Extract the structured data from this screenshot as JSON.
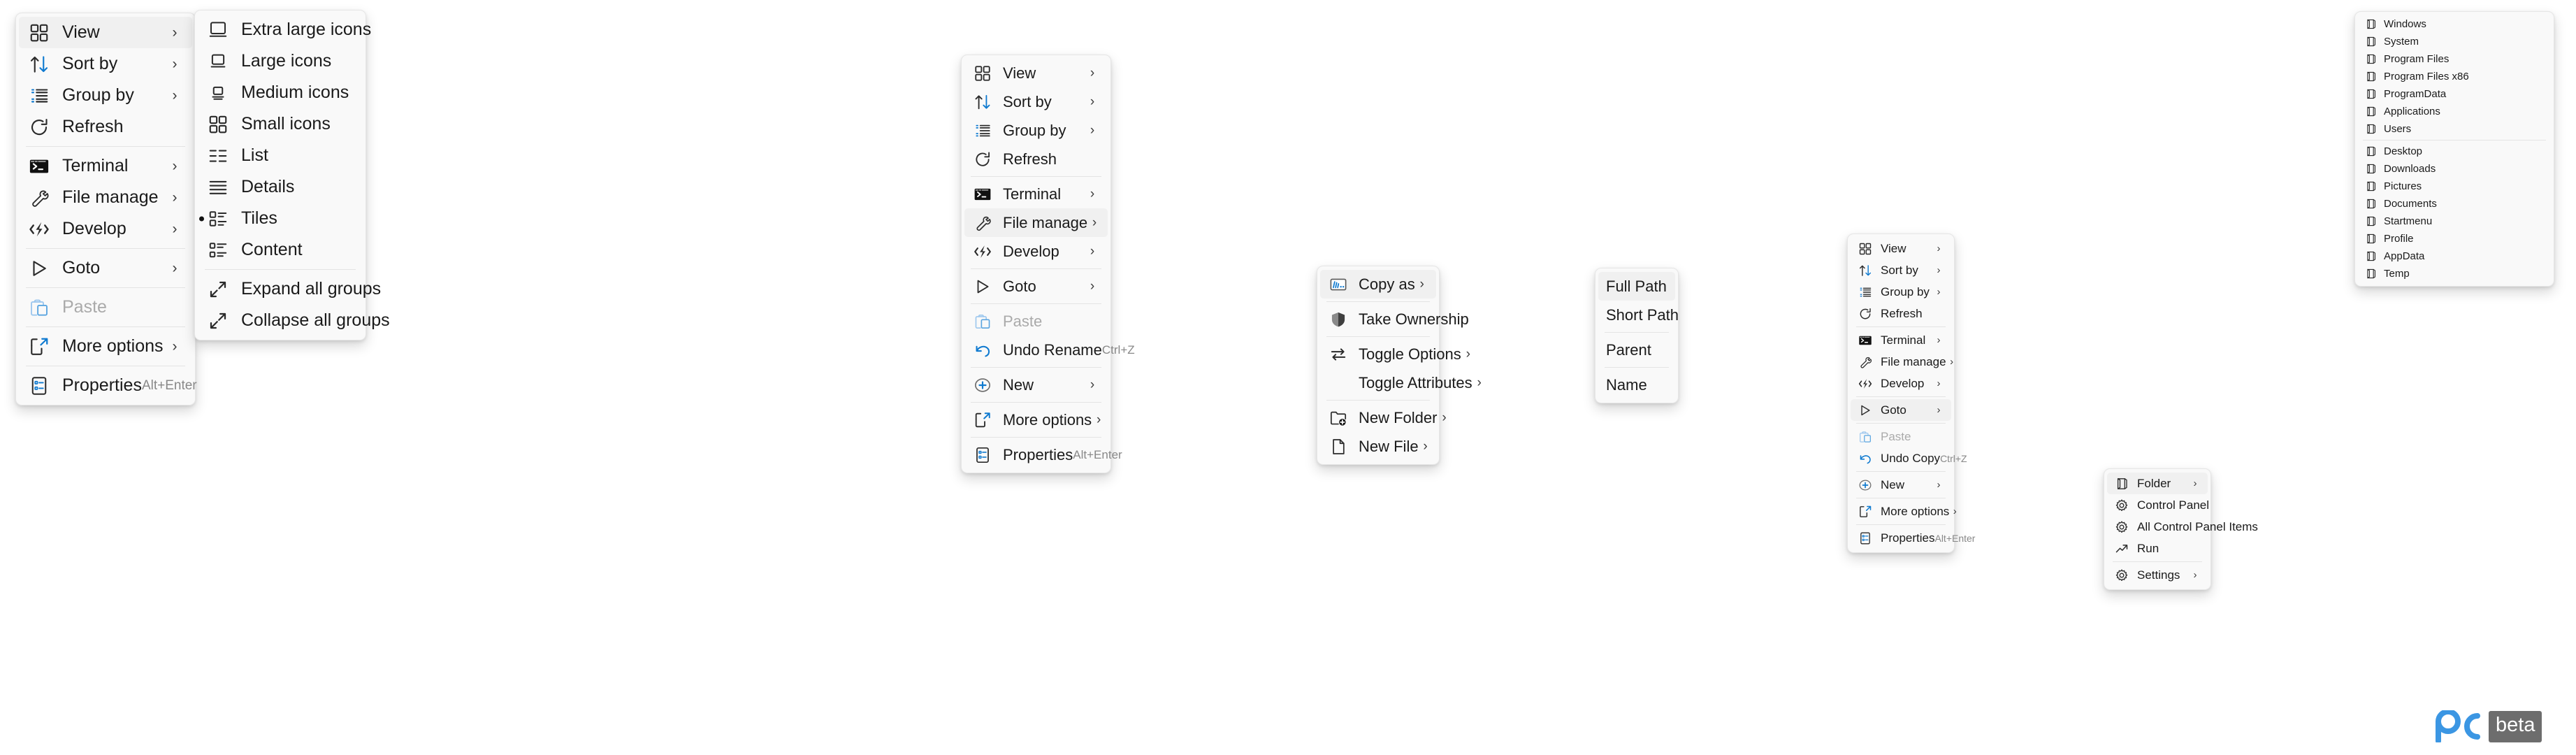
{
  "panels": {
    "root_context_menu": {
      "name": "Windows 11 desktop context menu",
      "items": [
        {
          "label": "View",
          "icon": "grid-icon",
          "submenu": true,
          "selected": true
        },
        {
          "label": "Sort by",
          "icon": "sort-icon",
          "submenu": true
        },
        {
          "label": "Group by",
          "icon": "group-icon",
          "submenu": true
        },
        {
          "label": "Refresh",
          "icon": "refresh-icon",
          "submenu": false
        },
        {
          "separator": true
        },
        {
          "label": "Terminal",
          "icon": "terminal-icon",
          "submenu": true
        },
        {
          "label": "File manage",
          "icon": "wrench-icon",
          "submenu": true
        },
        {
          "label": "Develop",
          "icon": "code-lightning-icon",
          "submenu": true
        },
        {
          "separator": true
        },
        {
          "label": "Goto",
          "icon": "play-arrow-icon",
          "submenu": true
        },
        {
          "separator": true
        },
        {
          "label": "Paste",
          "icon": "paste-icon",
          "submenu": false,
          "disabled": true
        },
        {
          "separator": true
        },
        {
          "label": "More options",
          "icon": "more-options-icon",
          "submenu": true
        },
        {
          "separator": true
        },
        {
          "label": "Properties",
          "icon": "properties-icon",
          "submenu": false,
          "accel": "Alt+Enter"
        }
      ]
    },
    "view_submenu": {
      "name": "View submenu",
      "items": [
        {
          "label": "Extra large icons",
          "icon": "monitor-xl-icon"
        },
        {
          "label": "Large icons",
          "icon": "monitor-l-icon"
        },
        {
          "label": "Medium icons",
          "icon": "monitor-m-icon"
        },
        {
          "label": "Small icons",
          "icon": "grid-icon"
        },
        {
          "label": "List",
          "icon": "list-icon"
        },
        {
          "label": "Details",
          "icon": "details-icon"
        },
        {
          "label": "Tiles",
          "icon": "tiles-icon",
          "bullet": true
        },
        {
          "label": "Content",
          "icon": "content-icon"
        },
        {
          "separator": true
        },
        {
          "label": "Expand all groups",
          "icon": "expand-icon"
        },
        {
          "label": "Collapse all groups",
          "icon": "collapse-icon"
        }
      ]
    },
    "second_context_menu": {
      "name": "Context menu with File manage highlighted",
      "items": [
        {
          "label": "View",
          "icon": "grid-icon",
          "submenu": true
        },
        {
          "label": "Sort by",
          "icon": "sort-icon",
          "submenu": true
        },
        {
          "label": "Group by",
          "icon": "group-icon",
          "submenu": true
        },
        {
          "label": "Refresh",
          "icon": "refresh-icon"
        },
        {
          "separator": true
        },
        {
          "label": "Terminal",
          "icon": "terminal-icon",
          "submenu": true
        },
        {
          "label": "File manage",
          "icon": "wrench-icon",
          "submenu": true,
          "selected": true
        },
        {
          "label": "Develop",
          "icon": "code-lightning-icon",
          "submenu": true
        },
        {
          "separator": true
        },
        {
          "label": "Goto",
          "icon": "play-arrow-icon",
          "submenu": true
        },
        {
          "separator": true
        },
        {
          "label": "Paste",
          "icon": "paste-icon",
          "disabled": true
        },
        {
          "label": "Undo Rename",
          "icon": "undo-icon",
          "accel": "Ctrl+Z"
        },
        {
          "separator": true
        },
        {
          "label": "New",
          "icon": "plus-circle-icon",
          "submenu": true
        },
        {
          "separator": true
        },
        {
          "label": "More options",
          "icon": "more-options-icon",
          "submenu": true
        },
        {
          "separator": true
        },
        {
          "label": "Properties",
          "icon": "properties-icon",
          "accel": "Alt+Enter"
        }
      ]
    },
    "file_manage_submenu": {
      "name": "File manage submenu",
      "items": [
        {
          "label": "Copy as",
          "icon": "copy-as-icon",
          "submenu": true,
          "selected": true
        },
        {
          "separator": true
        },
        {
          "label": "Take Ownership",
          "icon": "shield-icon"
        },
        {
          "separator": true
        },
        {
          "label": "Toggle Options",
          "icon": "toggle-swap-icon",
          "submenu": true
        },
        {
          "label": "Toggle Attributes",
          "icon": "none",
          "submenu": true
        },
        {
          "separator": true
        },
        {
          "label": "New Folder",
          "icon": "new-folder-icon",
          "submenu": true
        },
        {
          "label": "New File",
          "icon": "new-file-icon",
          "submenu": true
        }
      ]
    },
    "copy_as_submenu": {
      "name": "Copy as submenu",
      "items": [
        {
          "label": "Full Path",
          "selected": true
        },
        {
          "label": "Short Path"
        },
        {
          "separator": true
        },
        {
          "label": "Parent"
        },
        {
          "separator": true
        },
        {
          "label": "Name"
        }
      ]
    },
    "third_context_menu": {
      "name": "Context menu with Goto highlighted",
      "items": [
        {
          "label": "View",
          "icon": "grid-icon",
          "submenu": true
        },
        {
          "label": "Sort by",
          "icon": "sort-icon",
          "submenu": true
        },
        {
          "label": "Group by",
          "icon": "group-icon",
          "submenu": true
        },
        {
          "label": "Refresh",
          "icon": "refresh-icon"
        },
        {
          "separator": true
        },
        {
          "label": "Terminal",
          "icon": "terminal-icon",
          "submenu": true
        },
        {
          "label": "File manage",
          "icon": "wrench-icon",
          "submenu": true
        },
        {
          "label": "Develop",
          "icon": "code-lightning-icon",
          "submenu": true
        },
        {
          "separator": true
        },
        {
          "label": "Goto",
          "icon": "play-arrow-icon",
          "submenu": true,
          "selected": true
        },
        {
          "separator": true
        },
        {
          "label": "Paste",
          "icon": "paste-icon",
          "disabled": true
        },
        {
          "label": "Undo Copy",
          "icon": "undo-icon",
          "accel": "Ctrl+Z"
        },
        {
          "separator": true
        },
        {
          "label": "New",
          "icon": "plus-circle-icon",
          "submenu": true
        },
        {
          "separator": true
        },
        {
          "label": "More options",
          "icon": "more-options-icon",
          "submenu": true
        },
        {
          "separator": true
        },
        {
          "label": "Properties",
          "icon": "properties-icon",
          "accel": "Alt+Enter"
        }
      ]
    },
    "goto_submenu": {
      "name": "Goto submenu",
      "items": [
        {
          "label": "Folder",
          "icon": "folder-open-icon",
          "submenu": true,
          "selected": true
        },
        {
          "label": "Control Panel",
          "icon": "gear-icon"
        },
        {
          "label": "All Control Panel Items",
          "icon": "gear-icon"
        },
        {
          "label": "Run",
          "icon": "run-arrow-icon"
        },
        {
          "separator": true
        },
        {
          "label": "Settings",
          "icon": "gear-icon",
          "submenu": true
        }
      ]
    },
    "folder_submenu": {
      "name": "Folder submenu",
      "items": [
        {
          "label": "Windows",
          "icon": "folder-open-icon"
        },
        {
          "label": "System",
          "icon": "folder-open-icon"
        },
        {
          "label": "Program Files",
          "icon": "folder-open-icon"
        },
        {
          "label": "Program Files x86",
          "icon": "folder-open-icon"
        },
        {
          "label": "ProgramData",
          "icon": "folder-open-icon"
        },
        {
          "label": "Applications",
          "icon": "folder-open-icon"
        },
        {
          "label": "Users",
          "icon": "folder-open-icon"
        },
        {
          "separator": true
        },
        {
          "label": "Desktop",
          "icon": "folder-open-icon"
        },
        {
          "label": "Downloads",
          "icon": "folder-open-icon"
        },
        {
          "label": "Pictures",
          "icon": "folder-open-icon"
        },
        {
          "label": "Documents",
          "icon": "folder-open-icon"
        },
        {
          "label": "Startmenu",
          "icon": "folder-open-icon"
        },
        {
          "label": "Profile",
          "icon": "folder-open-icon"
        },
        {
          "label": "AppData",
          "icon": "folder-open-icon"
        },
        {
          "label": "Temp",
          "icon": "folder-open-icon"
        }
      ]
    }
  },
  "watermark": {
    "mark_text": "pc",
    "badge_text": "beta",
    "brand_color": "#3b96e3",
    "badge_color": "#6d6d6d"
  },
  "theme": {
    "menu_background": "#f9f9f9",
    "selected_row": "#f0f0f0",
    "text_color": "#1a1a1a",
    "disabled_text": "#aaaaaa",
    "accelerator_text": "#888888",
    "separator_color": "#e4e4e4",
    "accent_blue": "#0f7ad0"
  },
  "chevron_glyph": "›"
}
